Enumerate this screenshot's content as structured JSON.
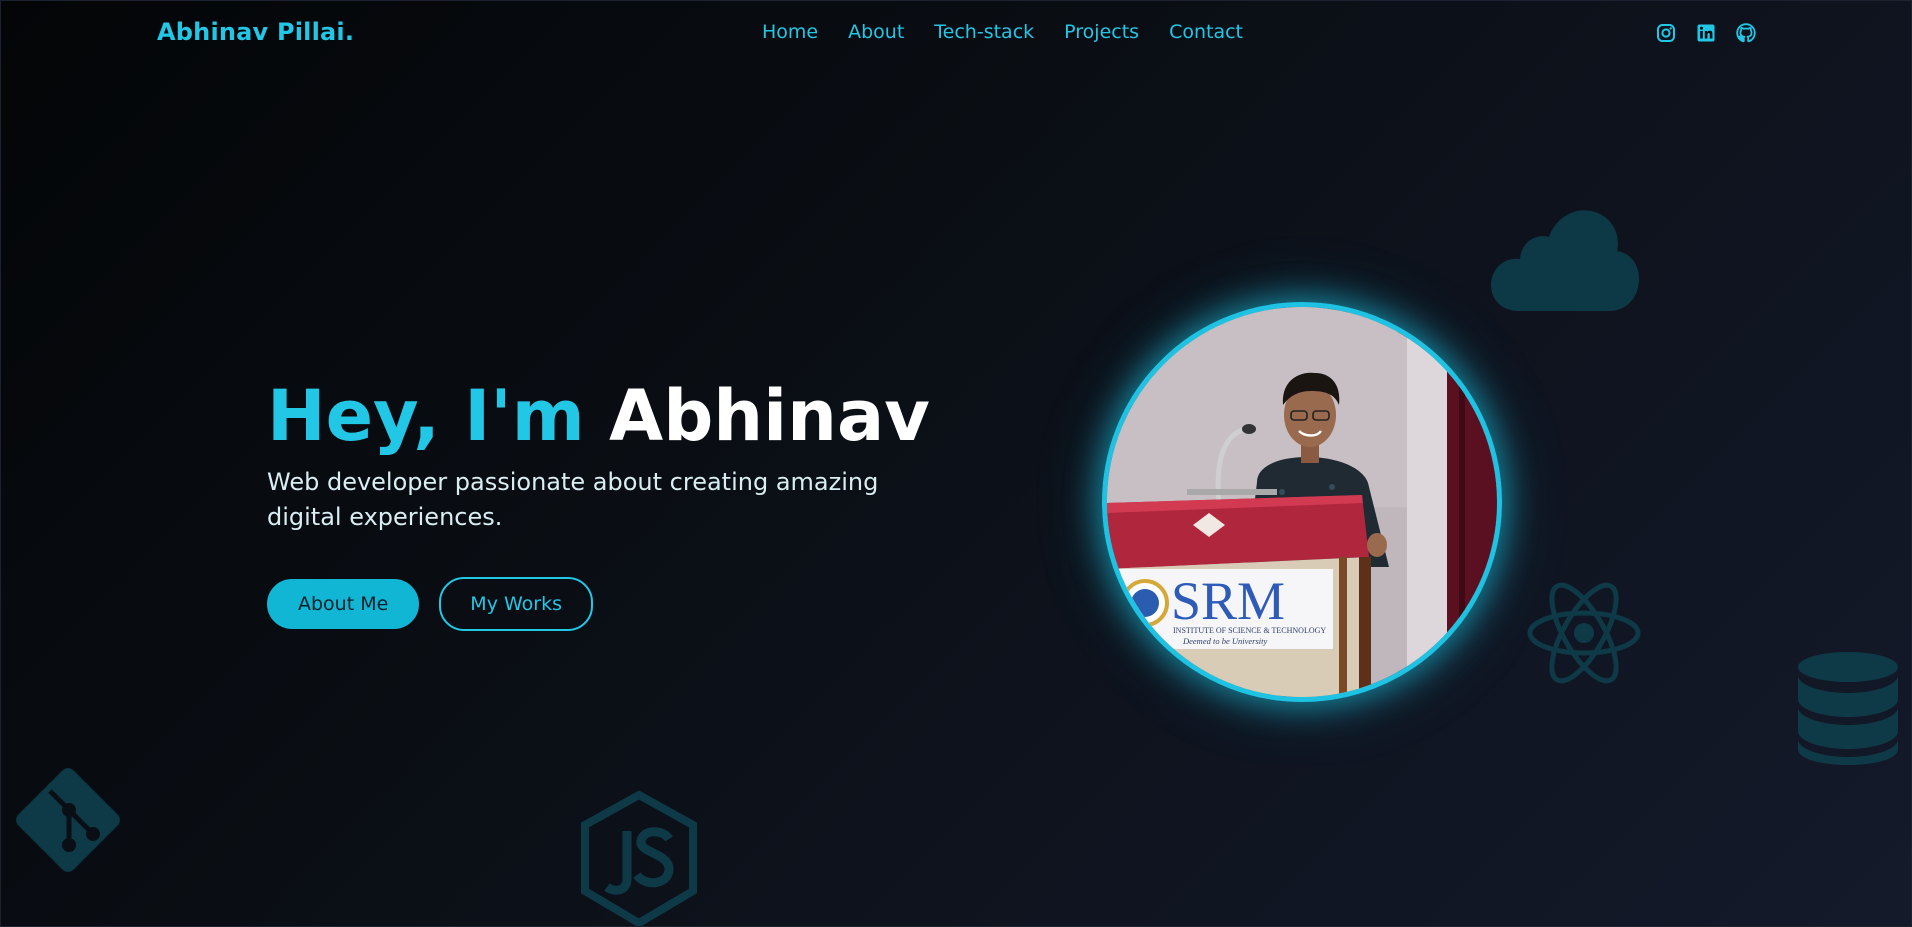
{
  "brand": {
    "name": "Abhinav Pillai."
  },
  "nav": {
    "items": [
      {
        "label": "Home"
      },
      {
        "label": "About"
      },
      {
        "label": "Tech-stack"
      },
      {
        "label": "Projects"
      },
      {
        "label": "Contact"
      }
    ]
  },
  "social": {
    "icons": [
      "instagram-icon",
      "linkedin-icon",
      "github-icon"
    ]
  },
  "hero": {
    "greeting": "Hey, I'm",
    "name": "Abhinav",
    "subtitle": "Web developer passionate about creating amazing digital experiences.",
    "primary_button": "About Me",
    "secondary_button": "My Works"
  },
  "profile": {
    "podium_logo_text": "SRM",
    "podium_line1": "INSTITUTE OF SCIENCE & TECHNOLOGY",
    "podium_line2": "Deemed to be University"
  },
  "decorations": [
    "cloud-icon",
    "react-icon",
    "database-icon",
    "git-icon",
    "nodejs-icon"
  ],
  "colors": {
    "accent": "#22c7e6",
    "button_fill": "#10b6d4",
    "heading_white": "#ffffff",
    "decor": "#0e3a48"
  }
}
